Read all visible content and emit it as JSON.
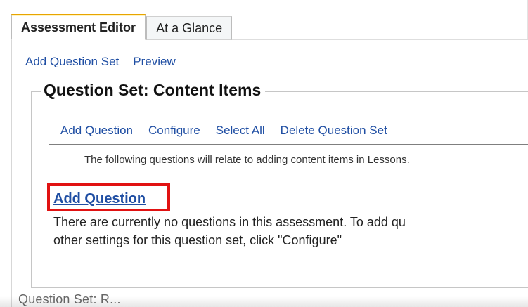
{
  "tabs": [
    {
      "label": "Assessment Editor",
      "active": true
    },
    {
      "label": "At a Glance",
      "active": false
    }
  ],
  "top_links": [
    {
      "label": "Add Question Set"
    },
    {
      "label": "Preview"
    }
  ],
  "question_set": {
    "title": "Question Set: Content Items",
    "toolbar": [
      {
        "label": "Add Question"
      },
      {
        "label": "Configure"
      },
      {
        "label": "Select All"
      },
      {
        "label": "Delete Question Set"
      }
    ],
    "info": "The following questions will relate to adding content items in Lessons.",
    "add_question_link": "Add Question",
    "message_line_1": "There are currently no questions in this assessment. To add qu",
    "message_line_2": "other settings for this question set, click \"Configure\""
  },
  "bottom_text": "Question Set: R..."
}
